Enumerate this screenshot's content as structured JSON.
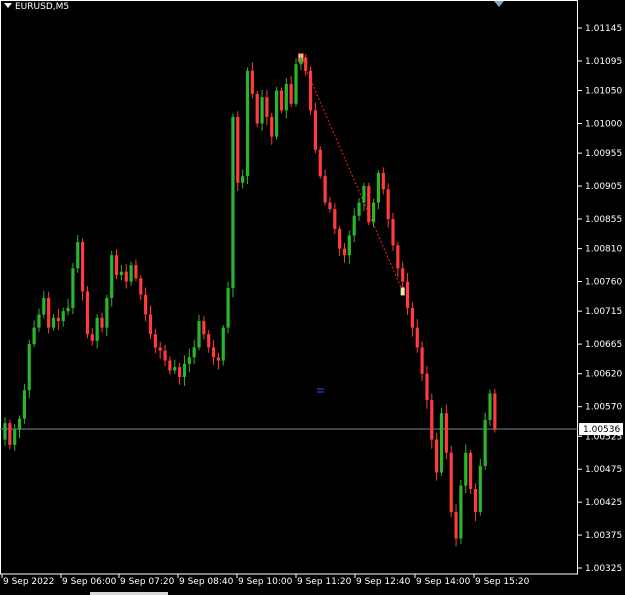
{
  "window": {
    "symbol": "EURUSD,M5"
  },
  "colors": {
    "background": "#000000",
    "grid_axis": "#ffffff",
    "bull": "#2bb52b",
    "bear": "#ff3b3b",
    "bid_line": "#6f8a9a",
    "current_price_box": "#ffffff",
    "trendline": "#ff2020"
  },
  "chart_data": {
    "type": "candlestick",
    "title": "",
    "symbol": "EURUSD",
    "timeframe": "M5",
    "y_ticks": [
      "1.01145",
      "1.01095",
      "1.01050",
      "1.01000",
      "1.00955",
      "1.00905",
      "1.00855",
      "1.00810",
      "1.00760",
      "1.00715",
      "1.00665",
      "1.00620",
      "1.00570",
      "1.00525",
      "1.00475",
      "1.00425",
      "1.00375",
      "1.00325"
    ],
    "ylim": [
      1.00317,
      1.0116
    ],
    "x_ticks": [
      "9 Sep 2022",
      "9 Sep 06:00",
      "9 Sep 07:20",
      "9 Sep 08:40",
      "9 Sep 10:00",
      "9 Sep 11:20",
      "9 Sep 12:40",
      "9 Sep 14:00",
      "9 Sep 15:20"
    ],
    "current_price": "1.00536",
    "candle_closes": [
      1.00545,
      1.00512,
      1.00535,
      1.00552,
      1.00595,
      1.00665,
      1.0069,
      1.0071,
      1.00735,
      1.0069,
      1.00705,
      1.007,
      1.00715,
      1.0072,
      1.0078,
      1.0082,
      1.00745,
      1.0068,
      1.0067,
      1.00705,
      1.0069,
      1.00735,
      1.008,
      1.0077,
      1.00775,
      1.0076,
      1.00785,
      1.00765,
      1.0074,
      1.0071,
      1.0068,
      1.0066,
      1.00655,
      1.0064,
      1.00625,
      1.0063,
      1.00615,
      1.00635,
      1.00645,
      1.0066,
      1.007,
      1.0068,
      1.0066,
      1.00645,
      1.0064,
      1.0069,
      1.0075,
      1.0101,
      1.0091,
      1.0092,
      1.0108,
      1.01045,
      1.01,
      1.0104,
      1.0101,
      1.0098,
      1.0105,
      1.0102,
      1.0106,
      1.0103,
      1.0109,
      1.011,
      1.0108,
      1.0102,
      1.0096,
      1.0092,
      1.0088,
      1.0087,
      1.0084,
      1.0081,
      1.008,
      1.0083,
      1.0086,
      1.0088,
      1.00905,
      1.0085,
      1.0088,
      1.00925,
      1.009,
      1.00855,
      1.00815,
      1.0078,
      1.0076,
      1.0072,
      1.0069,
      1.0066,
      1.0062,
      1.0058,
      1.0052,
      1.0047,
      1.0056,
      1.005,
      1.0041,
      1.0037,
      1.0045,
      1.005,
      1.00445,
      1.0041,
      1.0048,
      1.0055,
      1.0059,
      1.00535
    ]
  }
}
